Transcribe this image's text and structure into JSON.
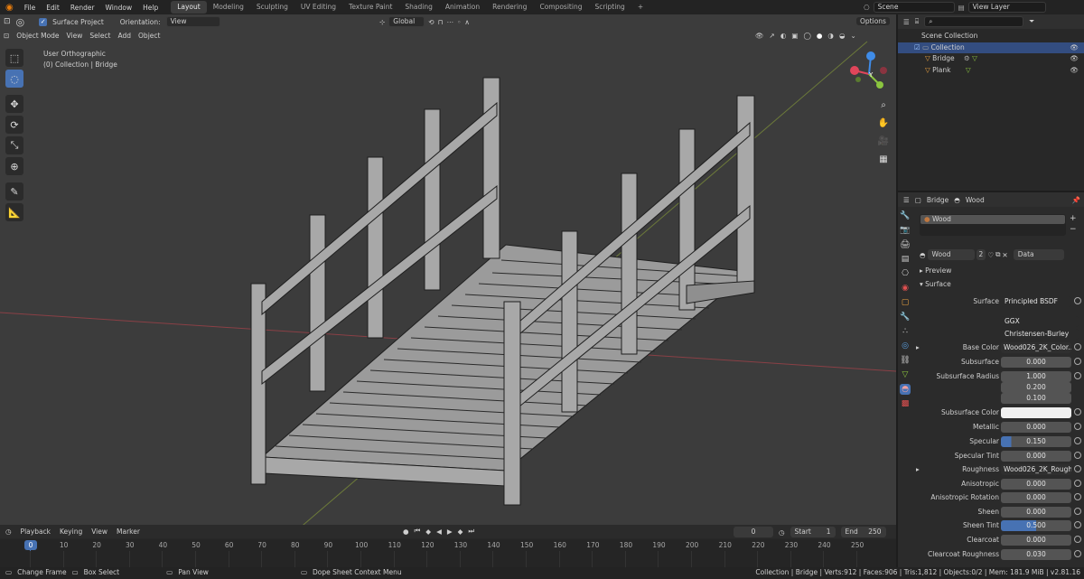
{
  "menu": {
    "items": [
      "File",
      "Edit",
      "Render",
      "Window",
      "Help"
    ]
  },
  "workspaces": [
    "Layout",
    "Modeling",
    "Sculpting",
    "UV Editing",
    "Texture Paint",
    "Shading",
    "Animation",
    "Rendering",
    "Compositing",
    "Scripting"
  ],
  "topright": {
    "scene": "Scene",
    "view_layer": "View Layer"
  },
  "tool_header": {
    "surface_project": "Surface Project",
    "orientation_label": "Orientation:",
    "orientation_value": "View",
    "transform": "Global",
    "options": "Options"
  },
  "viewport_header": {
    "mode": "Object Mode",
    "menus": [
      "View",
      "Select",
      "Add",
      "Object"
    ]
  },
  "viewport": {
    "view_name": "User Orthographic",
    "collection_info": "(0) Collection | Bridge"
  },
  "gizmo": {
    "x": "X",
    "y": "Y",
    "z": "Z"
  },
  "outliner": {
    "root": "Scene Collection",
    "collection": "Collection",
    "objects": [
      "Bridge",
      "Plank"
    ]
  },
  "props_header": {
    "object": "Bridge",
    "material": "Wood"
  },
  "material": {
    "slot": "Wood",
    "name": "Wood",
    "users": "2",
    "link": "Data",
    "preview": "Preview",
    "surface": "Surface"
  },
  "shader": {
    "surface_label": "Surface",
    "surface_value": "Principled BSDF",
    "distribution": "GGX",
    "subsurface_method": "Christensen-Burley",
    "rows": [
      {
        "label": "Base Color",
        "value": "Wood026_2K_Color..."
      },
      {
        "label": "Subsurface",
        "value": "0.000"
      },
      {
        "label": "Subsurface Radius",
        "value": "1.000"
      },
      {
        "label": "",
        "value": "0.200"
      },
      {
        "label": "",
        "value": "0.100"
      },
      {
        "label": "Subsurface Color",
        "value": ""
      },
      {
        "label": "Metallic",
        "value": "0.000"
      },
      {
        "label": "Specular",
        "value": "0.150"
      },
      {
        "label": "Specular Tint",
        "value": "0.000"
      },
      {
        "label": "Roughness",
        "value": "Wood026_2K_Rough..."
      },
      {
        "label": "Anisotropic",
        "value": "0.000"
      },
      {
        "label": "Anisotropic Rotation",
        "value": "0.000"
      },
      {
        "label": "Sheen",
        "value": "0.000"
      },
      {
        "label": "Sheen Tint",
        "value": "0.500"
      },
      {
        "label": "Clearcoat",
        "value": "0.000"
      },
      {
        "label": "Clearcoat Roughness",
        "value": "0.030"
      }
    ]
  },
  "timeline": {
    "menus": [
      "Playback",
      "Keying",
      "View",
      "Marker"
    ],
    "current_frame": "0",
    "start_label": "Start",
    "start": "1",
    "end_label": "End",
    "end": "250",
    "ruler": [
      "0",
      "10",
      "20",
      "30",
      "40",
      "50",
      "60",
      "70",
      "80",
      "90",
      "100",
      "110",
      "120",
      "130",
      "140",
      "150",
      "160",
      "170",
      "180",
      "190",
      "200",
      "210",
      "220",
      "230",
      "240",
      "250"
    ]
  },
  "statusbar": {
    "change_frame": "Change Frame",
    "box_select": "Box Select",
    "pan_view": "Pan View",
    "context_menu": "Dope Sheet Context Menu",
    "stats": "Collection | Bridge | Verts:912 | Faces:906 | Tris:1,812 | Objects:0/2 | Mem: 181.9 MiB | v2.81.16"
  },
  "colors": {
    "accent": "#4772b3",
    "viewport_bg": "#3c3c3c",
    "x_axis": "#e0455a",
    "y_axis": "#8bc53f",
    "z_axis": "#3f8ce8"
  }
}
